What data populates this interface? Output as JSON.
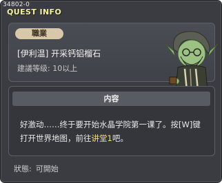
{
  "header": {
    "quest_id": "34802-0",
    "title": "QUEST INFO"
  },
  "info": {
    "job_tag": "職業",
    "quest_name": "[伊利温] 开采钙铝榴石",
    "level_requirement": "建議等级: 10以上"
  },
  "content": {
    "header": "内容",
    "text_before": "好激动……终于要开始水晶学院第一课了。按[W]键打开世界地图，前往",
    "text_highlight": "讲堂1",
    "text_after": "吧。"
  },
  "status": {
    "label": "狀態:",
    "value": "可開始"
  },
  "colors": {
    "title": "#f4f2a0",
    "highlight": "#f0e35a",
    "tag_bg": "#d8c7a9",
    "panel_bg": "#3a3c41"
  },
  "icons": {
    "npc": "elf-npc-portrait"
  }
}
